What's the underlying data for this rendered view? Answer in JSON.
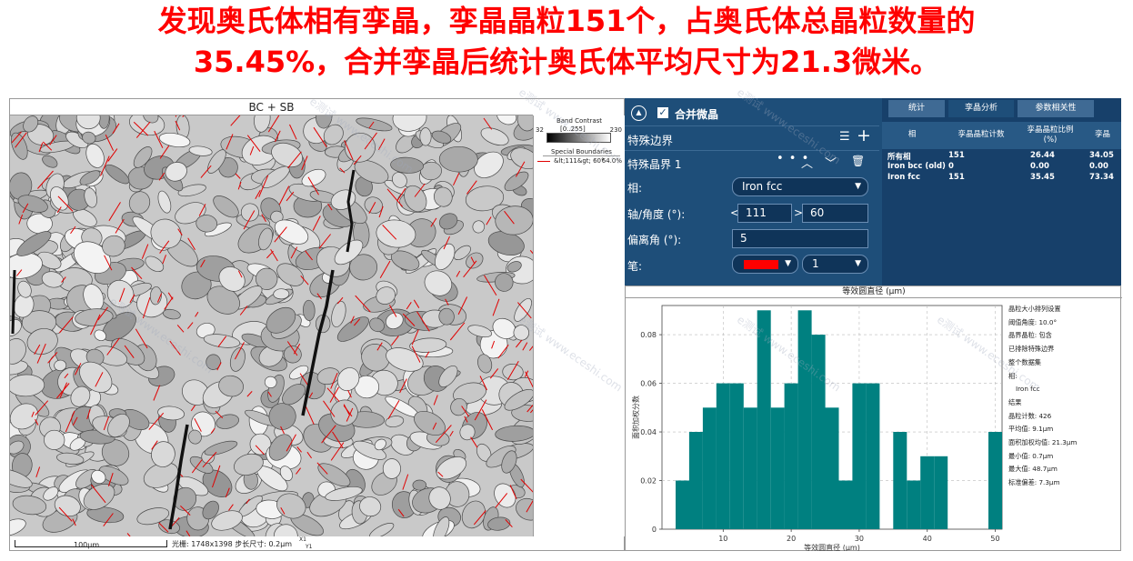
{
  "headline": {
    "line1": "发现奥氏体相有孪晶，孪晶晶粒151个，占奥氏体总晶粒数量的",
    "line2": "35.45%，合并孪晶后统计奥氏体平均尺寸为21.3微米。"
  },
  "map": {
    "title": "BC + SB",
    "legend": {
      "band_contrast": "Band Contrast",
      "range": "[0..255]",
      "min": "32",
      "max": "230",
      "special_boundaries": "Special Boundaries",
      "sb_item": "&lt;111&gt; 60°",
      "sb_pct": "64.0%",
      "sb_color": "#e00000"
    },
    "footer": {
      "scale": "100µm",
      "pixels": "光栅: 1748x1398   步长尺寸: 0.2µm",
      "axis_x": "X1",
      "axis_y": "Y1"
    }
  },
  "controls": {
    "merge_label": "合并微晶",
    "special_boundary": "特殊边界",
    "special_grain_boundary": "特殊晶界 1",
    "dots": "• • •",
    "phase_label": "相:",
    "phase_value": "Iron fcc",
    "axis_angle_label": "轴/角度 (°):",
    "axis_value": "111",
    "angle_value": "60",
    "deviation_label": "偏离角 (°):",
    "deviation_value": "5",
    "pen_label": "笔:",
    "pen_color": "#ff0000",
    "pen_width": "1"
  },
  "stats": {
    "tabs": [
      "统计",
      "孪晶分析",
      "参数相关性"
    ],
    "active_tab": 1,
    "headers": [
      "相",
      "孪晶晶粒计数",
      "孪晶晶粒比例 (%)",
      "孪晶"
    ],
    "rows": [
      [
        "所有相",
        "151",
        "26.44",
        "34.05"
      ],
      [
        "Iron bcc (old)",
        "0",
        "0.00",
        "0.00"
      ],
      [
        "Iron fcc",
        "151",
        "35.45",
        "73.34"
      ]
    ]
  },
  "hist": {
    "title": "等效圆直径 (µm)",
    "info": [
      "晶粒大小排列设置",
      "阈值角度: 10.0°",
      "晶界晶粒: 包含",
      "已排除特殊边界",
      "整个数据集",
      "相:",
      "Iron fcc",
      "结果",
      "晶粒计数: 426",
      "平均值: 9.1µm",
      "面积加权均值: 21.3µm",
      "最小值: 0.7µm",
      "最大值: 48.7µm",
      "标准偏差: 7.3µm"
    ]
  },
  "chart_data": {
    "type": "bar",
    "xlabel": "等效圆直径 (µm)",
    "ylabel": "面积加权分数",
    "xlim": [
      1,
      51
    ],
    "ylim": [
      0,
      0.092
    ],
    "x_ticks": [
      10,
      20,
      30,
      40,
      50
    ],
    "y_ticks": [
      "0",
      "0.02",
      "0.04",
      "0.06",
      "0.08"
    ],
    "bar_color": "#008080",
    "bin_width": 2,
    "bin_starts": [
      3,
      5,
      7,
      9,
      11,
      13,
      15,
      17,
      19,
      21,
      23,
      25,
      27,
      29,
      31,
      33,
      35,
      37,
      39,
      41,
      43,
      45,
      47,
      49
    ],
    "values": [
      0.02,
      0.04,
      0.05,
      0.06,
      0.06,
      0.05,
      0.09,
      0.05,
      0.06,
      0.09,
      0.08,
      0.05,
      0.02,
      0.06,
      0.06,
      0.0,
      0.04,
      0.02,
      0.03,
      0.03,
      0.0,
      0.0,
      0.0,
      0.04
    ]
  },
  "watermark": "e测试 www.eceshi.com"
}
